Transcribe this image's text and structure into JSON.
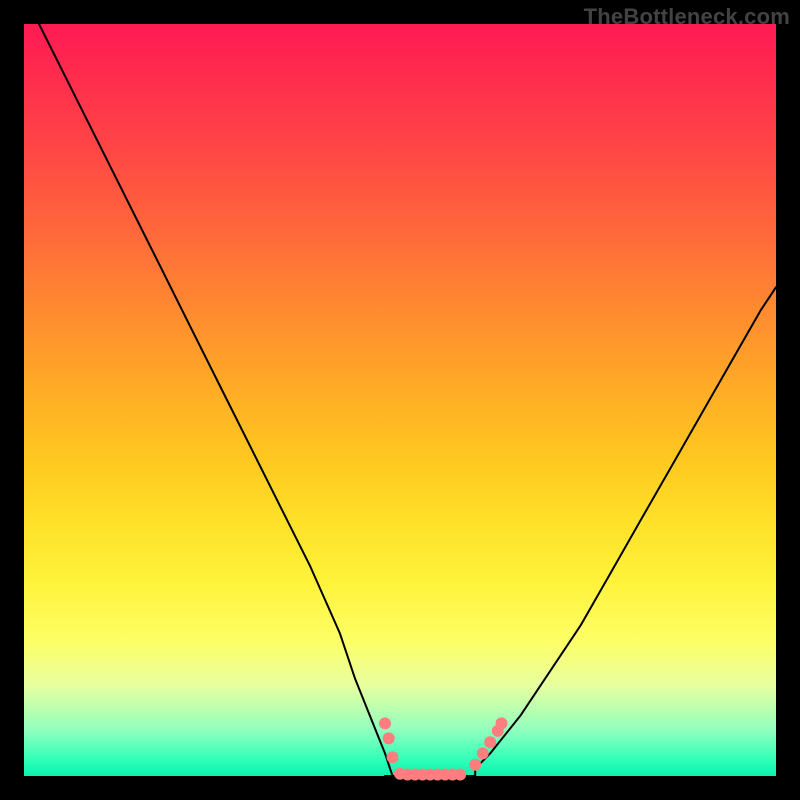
{
  "watermark": "TheBottleneck.com",
  "colors": {
    "frame": "#000000",
    "watermark_text": "#434343",
    "curve_stroke": "#000000",
    "dot_fill": "#fd7e7e",
    "gradient_top": "#ff1a53",
    "gradient_bottom": "#0cf2ae"
  },
  "chart_data": {
    "type": "line",
    "title": "",
    "xlabel": "",
    "ylabel": "",
    "xlim": [
      0,
      100
    ],
    "ylim": [
      0,
      100
    ],
    "annotations": [],
    "series": [
      {
        "name": "left-curve",
        "x": [
          2,
          6,
          10,
          14,
          18,
          22,
          26,
          30,
          34,
          38,
          42,
          44,
          46,
          48,
          49
        ],
        "y": [
          100,
          92,
          84,
          76,
          68,
          60,
          52,
          44,
          36,
          28,
          19,
          13,
          8,
          3,
          0
        ]
      },
      {
        "name": "valley-floor",
        "x": [
          48,
          50,
          52,
          54,
          56,
          58,
          60
        ],
        "y": [
          0,
          0,
          0,
          0,
          0,
          0,
          0
        ]
      },
      {
        "name": "right-curve",
        "x": [
          60,
          62,
          66,
          70,
          74,
          78,
          82,
          86,
          90,
          94,
          98,
          100
        ],
        "y": [
          1,
          3,
          8,
          14,
          20,
          27,
          34,
          41,
          48,
          55,
          62,
          65
        ]
      }
    ],
    "markers": [
      {
        "x": 48.0,
        "y": 7.0
      },
      {
        "x": 48.5,
        "y": 5.0
      },
      {
        "x": 49.0,
        "y": 2.5
      },
      {
        "x": 50.0,
        "y": 0.3
      },
      {
        "x": 51.0,
        "y": 0.2
      },
      {
        "x": 52.0,
        "y": 0.2
      },
      {
        "x": 53.0,
        "y": 0.2
      },
      {
        "x": 54.0,
        "y": 0.2
      },
      {
        "x": 55.0,
        "y": 0.2
      },
      {
        "x": 56.0,
        "y": 0.2
      },
      {
        "x": 57.0,
        "y": 0.2
      },
      {
        "x": 58.0,
        "y": 0.2
      },
      {
        "x": 60.0,
        "y": 1.5
      },
      {
        "x": 61.0,
        "y": 3.0
      },
      {
        "x": 62.0,
        "y": 4.5
      },
      {
        "x": 63.0,
        "y": 6.0
      },
      {
        "x": 63.5,
        "y": 7.0
      }
    ],
    "marker_radius": 6
  }
}
